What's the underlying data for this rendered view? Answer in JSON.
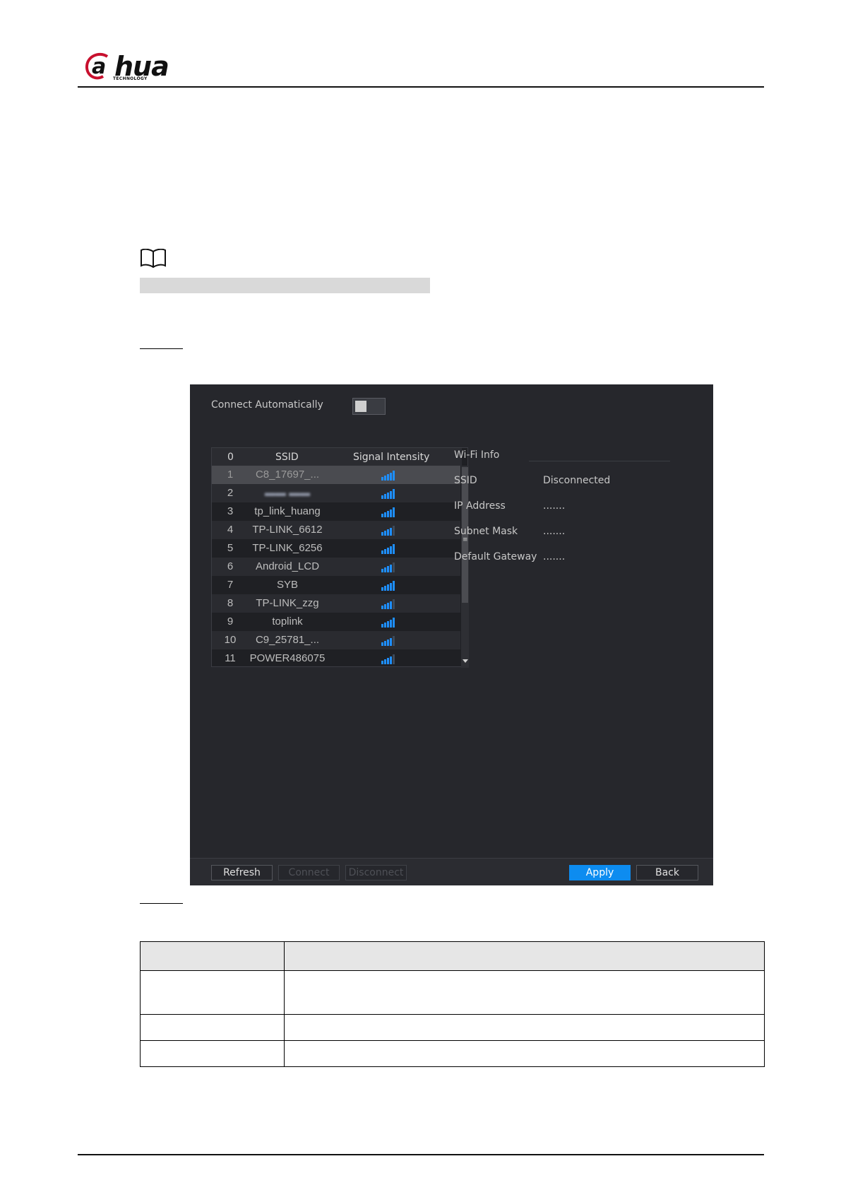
{
  "header": {
    "brand": "alhua",
    "brand_sub": "TECHNOLOGY"
  },
  "wifi_panel": {
    "connect_auto_label": "Connect Automatically",
    "connect_auto_enabled": false,
    "list": {
      "columns": [
        "0",
        "SSID",
        "Signal Intensity"
      ],
      "rows": [
        {
          "no": "1",
          "ssid": "C8_17697_...",
          "signal_bars": 5,
          "selected": true
        },
        {
          "no": "2",
          "ssid": "",
          "signal_bars": 5,
          "blurred": true
        },
        {
          "no": "3",
          "ssid": "tp_link_huang",
          "signal_bars": 5
        },
        {
          "no": "4",
          "ssid": "TP-LINK_6612",
          "signal_bars": 4
        },
        {
          "no": "5",
          "ssid": "TP-LINK_6256",
          "signal_bars": 5
        },
        {
          "no": "6",
          "ssid": "Android_LCD",
          "signal_bars": 4
        },
        {
          "no": "7",
          "ssid": "SYB",
          "signal_bars": 5
        },
        {
          "no": "8",
          "ssid": "TP-LINK_zzg",
          "signal_bars": 4
        },
        {
          "no": "9",
          "ssid": "toplink",
          "signal_bars": 5
        },
        {
          "no": "10",
          "ssid": "C9_25781_...",
          "signal_bars": 4
        },
        {
          "no": "11",
          "ssid": "POWER486075",
          "signal_bars": 4
        }
      ]
    },
    "info": {
      "title": "Wi-Fi Info",
      "ssid_label": "SSID",
      "ssid_value": "Disconnected",
      "ip_label": "IP Address",
      "ip_value": ".......",
      "mask_label": "Subnet Mask",
      "mask_value": ".......",
      "gateway_label": "Default Gateway",
      "gateway_value": "......."
    },
    "buttons": {
      "refresh": "Refresh",
      "connect": "Connect",
      "disconnect": "Disconnect",
      "apply": "Apply",
      "back": "Back"
    },
    "colors": {
      "accent": "#0d8cf0",
      "panel_bg": "#26272c",
      "signal": "#1e8fff"
    }
  }
}
